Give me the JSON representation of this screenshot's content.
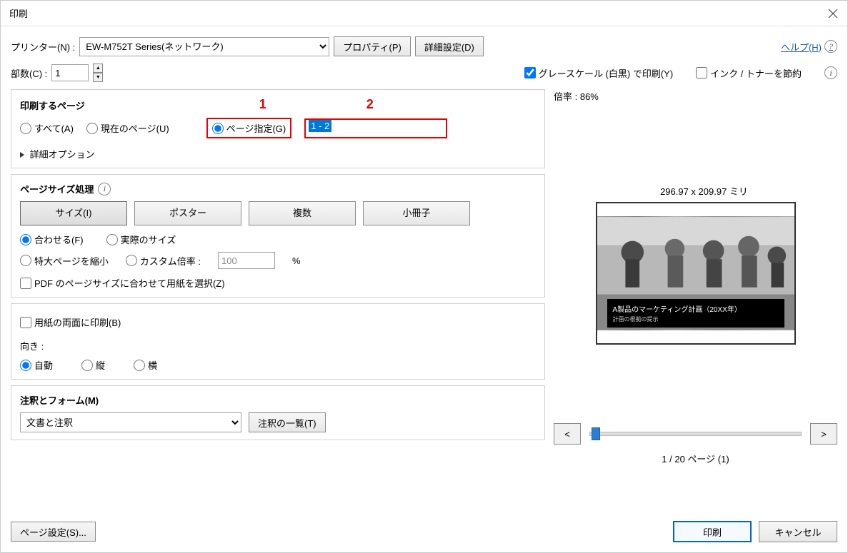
{
  "title": "印刷",
  "printer": {
    "label": "プリンター(N) :",
    "value": "EW-M752T Series(ネットワーク)",
    "properties_btn": "プロパティ(P)",
    "advanced_btn": "詳細設定(D)"
  },
  "help_link": "ヘルプ(H)",
  "copies": {
    "label": "部数(C) :",
    "value": "1"
  },
  "grayscale": {
    "label": "グレースケール (白黒) で印刷(Y)",
    "checked": true
  },
  "save_ink": {
    "label": "インク / トナーを節約",
    "checked": false
  },
  "pages_to_print": {
    "title": "印刷するページ",
    "all": "すべて(A)",
    "current": "現在のページ(U)",
    "specify": "ページ指定(G)",
    "range_value": "1 - 2",
    "more_options": "詳細オプション",
    "annotation1": "1",
    "annotation2": "2"
  },
  "page_sizing": {
    "title": "ページサイズ処理",
    "tabs": {
      "size": "サイズ(I)",
      "poster": "ポスター",
      "multiple": "複数",
      "booklet": "小冊子"
    },
    "fit": "合わせる(F)",
    "actual": "実際のサイズ",
    "shrink": "特大ページを縮小",
    "custom": "カスタム倍率 :",
    "custom_value": "100",
    "custom_pct": "%",
    "pdf_paper": "PDF のページサイズに合わせて用紙を選択(Z)"
  },
  "duplex": {
    "label": "用紙の両面に印刷(B)",
    "checked": false
  },
  "orientation": {
    "label": "向き :",
    "auto": "自動",
    "portrait": "縦",
    "landscape": "横"
  },
  "comments": {
    "title": "注釈とフォーム(M)",
    "value": "文書と注釈",
    "summary_btn": "注釈の一覧(T)"
  },
  "preview": {
    "zoom_label": "倍率 : 86%",
    "dims": "296.97 x 209.97 ミリ",
    "slide_title": "A製品のマーケティング計画（20XX年）",
    "slide_sub": "計画の根拠の提示",
    "prev": "<",
    "next": ">",
    "page_indicator": "1 / 20 ページ (1)"
  },
  "bottom": {
    "page_setup": "ページ設定(S)...",
    "print": "印刷",
    "cancel": "キャンセル"
  }
}
